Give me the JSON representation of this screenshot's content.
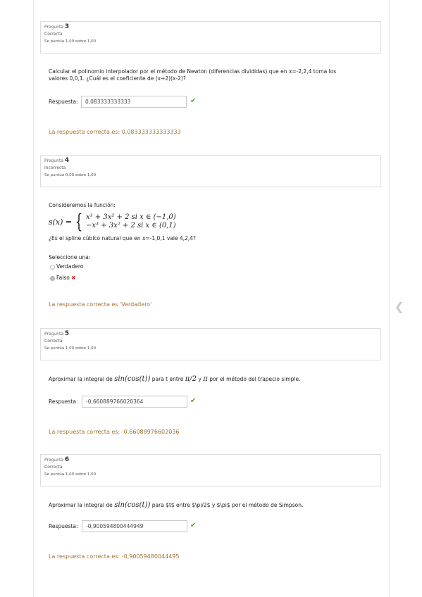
{
  "questions": [
    {
      "label": "Pregunta",
      "number": "3",
      "state": "Correcta",
      "score": "Se puntúa 1,00 sobre 1,00",
      "text_line1": "Calcular el polinomio interpolador por el método de Newton (diferencias divididas) que en x=-2,2,4 toma los",
      "text_line2": "valores 0,0,1. ¿Cuál es el coeficiente de (x+2)(x-2)?",
      "response_label": "Respuesta:",
      "response_value": "0,083333333333",
      "feedback": "La respuesta correcta es: 0,083333333333333"
    },
    {
      "label": "Pregunta",
      "number": "4",
      "state": "Incorrecta",
      "score": "Se puntúa 0,00 sobre 1,00",
      "text_line1": "Consideremos la función:",
      "formula_lhs": "s(x) =",
      "formula_case1": "x³ + 3x² + 2 si x ∈ (−1,0)",
      "formula_case2": "−x³ + 3x² + 2 si x ∈ (0,1)",
      "text_line2": "¿Es el spline cúbico natural que en x=-1,0,1 vale 4,2,4?",
      "select_label": "Seleccione una:",
      "options": [
        "Verdadero",
        "Falso"
      ],
      "selected": "Falso",
      "feedback": "La respuesta correcta es 'Verdadero'"
    },
    {
      "label": "Pregunta",
      "number": "5",
      "state": "Correcta",
      "score": "Se puntúa 1,00 sobre 1,00",
      "text_prefix": "Aproximar la integral de",
      "text_math": "sin(cos(t))",
      "text_mid": "para t entre",
      "text_math2": "π/2",
      "text_mid2": "y",
      "text_math3": "π",
      "text_suffix": "por el método del trapecio simple.",
      "response_label": "Respuesta:",
      "response_value": "-0,660889766020364",
      "feedback": "La respuesta correcta es: -0,66088976602036"
    },
    {
      "label": "Pregunta",
      "number": "6",
      "state": "Correcta",
      "score": "Se puntúa 1,00 sobre 1,00",
      "text_prefix": "Aproximar la integral de",
      "text_math": "sin(cos(t))",
      "text_suffix": "para $t$ entre $\\pi/2$ y $\\pi$ por el método de Simpson.",
      "response_label": "Respuesta:",
      "response_value": "-0,900594800444949",
      "feedback": "La respuesta correcta es: -0,90059480044495"
    }
  ],
  "colors": {
    "correct_check": "#5a9a31",
    "wrong_mark": "#c9302c",
    "feedback_text": "#a1742f"
  },
  "icons": {
    "check": "check-icon",
    "wrong": "cross-icon",
    "nav": "chevron-left-icon"
  }
}
